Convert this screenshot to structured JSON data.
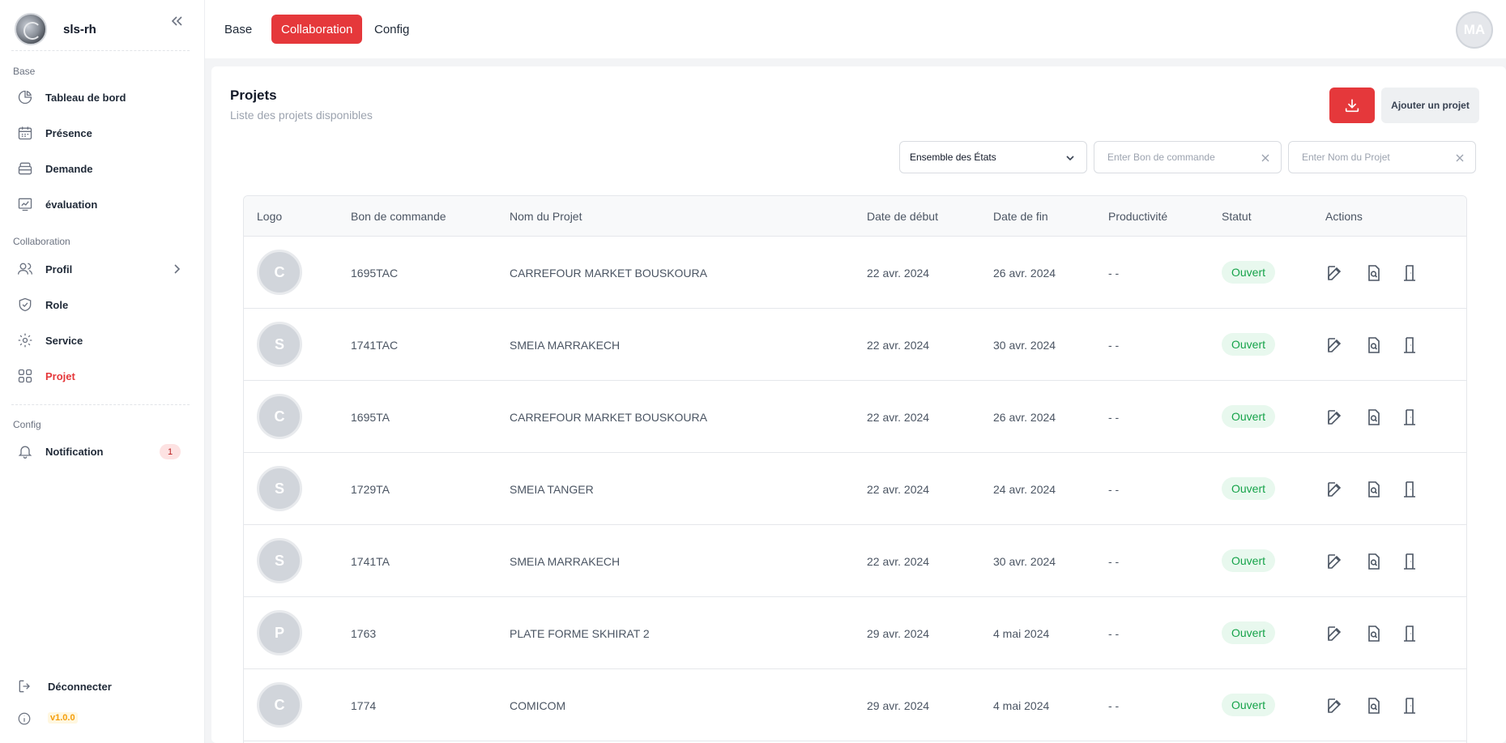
{
  "app": {
    "name": "sls-rh",
    "version": "v1.0.0"
  },
  "sidebar": {
    "sections": [
      {
        "label": "Base"
      },
      {
        "label": "Collaboration"
      },
      {
        "label": "Config"
      }
    ],
    "items": [
      {
        "label": "Tableau de bord",
        "icon": "chart-pie-icon"
      },
      {
        "label": "Présence",
        "icon": "calendar-icon"
      },
      {
        "label": "Demande",
        "icon": "inbox-icon"
      },
      {
        "label": "évaluation",
        "icon": "chart-line-icon"
      },
      {
        "label": "Profil",
        "icon": "users-icon"
      },
      {
        "label": "Role",
        "icon": "shield-check-icon"
      },
      {
        "label": "Service",
        "icon": "gear-icon"
      },
      {
        "label": "Projet",
        "icon": "grid-icon",
        "active": true
      },
      {
        "label": "Notification",
        "icon": "bell-icon",
        "badge": "1"
      }
    ],
    "logout_label": "Déconnecter"
  },
  "topbar": {
    "tabs": [
      {
        "label": "Base"
      },
      {
        "label": "Collaboration",
        "active": true
      },
      {
        "label": "Config"
      }
    ],
    "avatar_initials": "MA"
  },
  "page": {
    "title": "Projets",
    "subtitle": "Liste des projets disponibles",
    "add_button": "Ajouter un projet"
  },
  "filters": {
    "status_select": "Ensemble des États",
    "po_placeholder": "Enter Bon de commande",
    "name_placeholder": "Enter Nom du Projet"
  },
  "table": {
    "columns": [
      "Logo",
      "Bon de commande",
      "Nom du Projet",
      "Date de début",
      "Date de fin",
      "Productivité",
      "Statut",
      "Actions"
    ],
    "rows": [
      {
        "logo": "C",
        "po": "1695TAC",
        "name": "CARREFOUR MARKET BOUSKOURA",
        "start": "22 avr. 2024",
        "end": "26 avr. 2024",
        "productivity": "- -",
        "status": "Ouvert"
      },
      {
        "logo": "S",
        "po": "1741TAC",
        "name": "SMEIA MARRAKECH",
        "start": "22 avr. 2024",
        "end": "30 avr. 2024",
        "productivity": "- -",
        "status": "Ouvert"
      },
      {
        "logo": "C",
        "po": "1695TA",
        "name": "CARREFOUR MARKET BOUSKOURA",
        "start": "22 avr. 2024",
        "end": "26 avr. 2024",
        "productivity": "- -",
        "status": "Ouvert"
      },
      {
        "logo": "S",
        "po": "1729TA",
        "name": "SMEIA TANGER",
        "start": "22 avr. 2024",
        "end": "24 avr. 2024",
        "productivity": "- -",
        "status": "Ouvert"
      },
      {
        "logo": "S",
        "po": "1741TA",
        "name": "SMEIA MARRAKECH",
        "start": "22 avr. 2024",
        "end": "30 avr. 2024",
        "productivity": "- -",
        "status": "Ouvert"
      },
      {
        "logo": "P",
        "po": "1763",
        "name": "PLATE FORME SKHIRAT 2",
        "start": "29 avr. 2024",
        "end": "4 mai 2024",
        "productivity": "- -",
        "status": "Ouvert"
      },
      {
        "logo": "C",
        "po": "1774",
        "name": "COMICOM",
        "start": "29 avr. 2024",
        "end": "4 mai 2024",
        "productivity": "- -",
        "status": "Ouvert"
      }
    ]
  },
  "colors": {
    "accent": "#e5383b",
    "status_open_bg": "#e8f8ee",
    "status_open_text": "#16a34a"
  }
}
